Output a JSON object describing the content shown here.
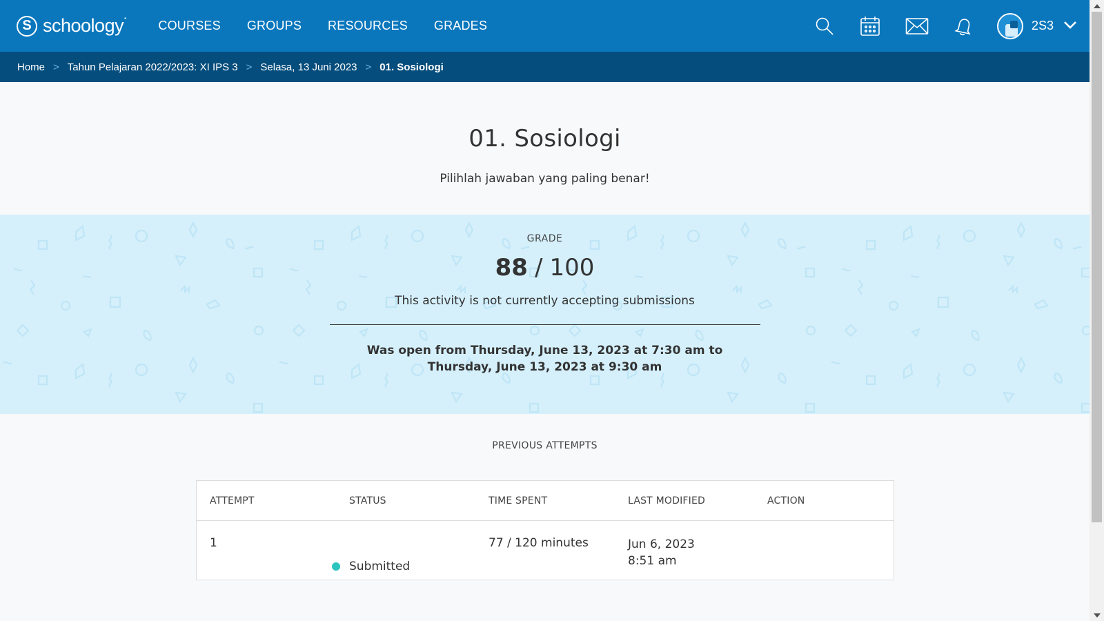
{
  "topnav": {
    "brand": "schoology",
    "brand_mark": "S",
    "links": [
      "COURSES",
      "GROUPS",
      "RESOURCES",
      "GRADES"
    ],
    "icons": [
      "search-icon",
      "calendar-icon",
      "mail-icon",
      "bell-icon",
      "chevron-down-icon"
    ],
    "user_name": "2S3"
  },
  "breadcrumb": {
    "items": [
      "Home",
      "Tahun Pelajaran 2022/2023: XI IPS 3",
      "Selasa, 13 Juni 2023",
      "01. Sosiologi"
    ],
    "separator": ">"
  },
  "header": {
    "title": "01. Sosiologi",
    "instructions": "Pilihlah jawaban yang paling benar!"
  },
  "grade": {
    "label": "GRADE",
    "score": "88",
    "slash": "/",
    "total": "100",
    "note": "This activity is not currently accepting submissions",
    "open_window": "Was open from Thursday, June 13, 2023 at 7:30 am to Thursday, June 13, 2023 at 9:30 am"
  },
  "attempts": {
    "label": "PREVIOUS ATTEMPTS",
    "columns": [
      "ATTEMPT",
      "STATUS",
      "TIME SPENT",
      "LAST MODIFIED",
      "ACTION"
    ],
    "rows": [
      {
        "attempt": "1",
        "status": "Submitted",
        "time_spent": "77 / 120 minutes",
        "last_modified_date": "Jun 6, 2023",
        "last_modified_time": "8:51 am",
        "action": ""
      }
    ]
  },
  "colors": {
    "nav": "#0a77bd",
    "breadcrumb": "#054d7c",
    "grade_band": "#d5f0fb",
    "status_submitted": "#2dc4bf"
  }
}
